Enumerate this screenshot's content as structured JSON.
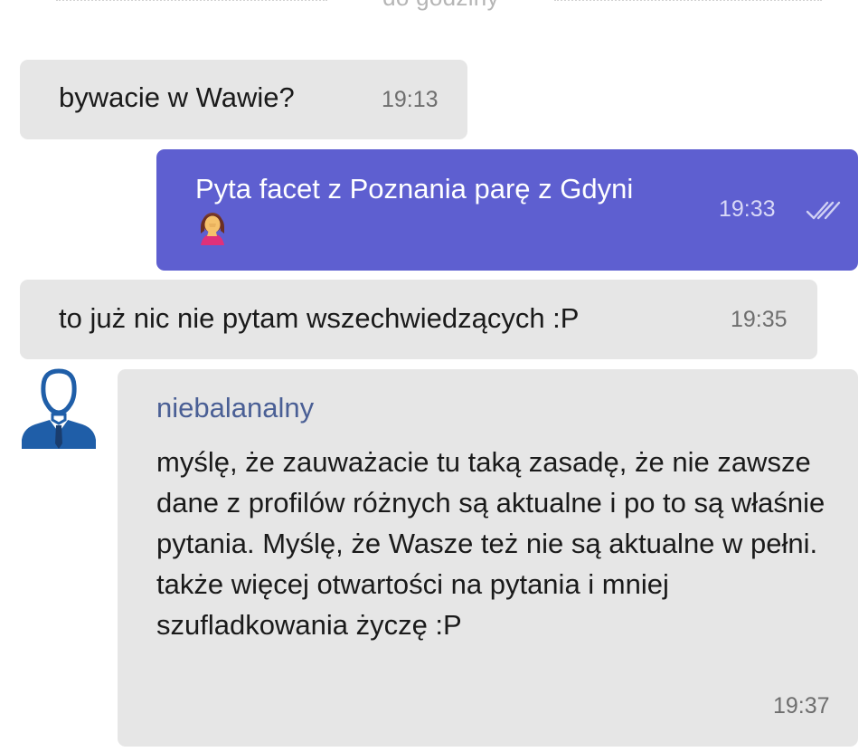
{
  "date_divider": {
    "label": "do godziny"
  },
  "messages": [
    {
      "direction": "incoming",
      "text": "bywacie w Wawie?",
      "time": "19:13"
    },
    {
      "direction": "outgoing",
      "text": "Pyta facet z Poznania parę z Gdyni",
      "emoji": "face-palm-woman",
      "time": "19:33",
      "status": "read"
    },
    {
      "direction": "incoming",
      "text": "to już nic nie pytam wszechwiedzących :P",
      "time": "19:35"
    },
    {
      "direction": "incoming",
      "author": "niebalanalny",
      "avatar": "user-avatar-icon",
      "text": "myślę, że zauważacie tu taką zasadę, że nie zawsze dane z profilów różnych są aktualne i po to są właśnie pytania. Myślę, że Wasze też nie są aktualne w pełni. także więcej otwartości na pytania i mniej szufladkowania życzę :P",
      "time": "19:37"
    }
  ],
  "colors": {
    "incoming_bubble": "#e6e6e6",
    "outgoing_bubble": "#5e5fd0",
    "author_name": "#4a5f95",
    "avatar": "#1f5ea8"
  }
}
